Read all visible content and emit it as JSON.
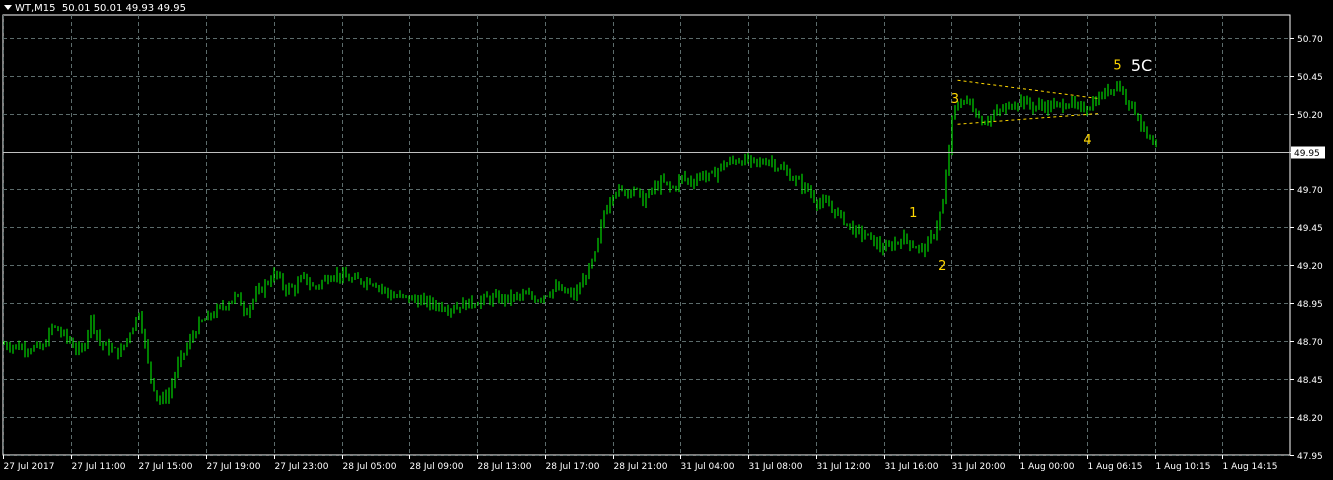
{
  "header": {
    "symbol_timeframe": "WT,M15",
    "ohlc_text": "50.01 50.01 49.93 49.95"
  },
  "colors": {
    "background": "#000000",
    "grid": "#5c6b6b",
    "candle": "#00ff00",
    "axis_text": "#ffffff",
    "price_line": "#c0c0c0",
    "wave_label": "#ffd700",
    "channel": "#ffd700"
  },
  "chart_data": {
    "type": "line",
    "title": "",
    "xlabel": "",
    "ylabel": "",
    "ylim": [
      47.95,
      50.85
    ],
    "grid": true,
    "y_ticks": [
      "50.70",
      "50.45",
      "50.20",
      "49.95",
      "49.70",
      "49.45",
      "49.20",
      "48.95",
      "48.70",
      "48.45",
      "48.20",
      "47.95"
    ],
    "x_ticks": [
      "27 Jul 2017",
      "27 Jul 11:00",
      "27 Jul 15:00",
      "27 Jul 19:00",
      "27 Jul 23:00",
      "28 Jul 05:00",
      "28 Jul 09:00",
      "28 Jul 13:00",
      "28 Jul 17:00",
      "28 Jul 21:00",
      "31 Jul 04:00",
      "31 Jul 08:00",
      "31 Jul 12:00",
      "31 Jul 16:00",
      "31 Jul 20:00",
      "1 Aug 00:00",
      "1 Aug 06:15",
      "1 Aug 10:15",
      "1 Aug 14:15"
    ],
    "current_price": "49.95",
    "series": [
      {
        "values": [
          [
            0,
            48.68
          ],
          [
            2,
            48.66
          ],
          [
            4,
            48.65
          ],
          [
            5,
            48.8
          ],
          [
            6,
            48.75
          ],
          [
            8,
            48.62
          ],
          [
            9,
            48.85
          ],
          [
            10,
            48.68
          ],
          [
            12,
            48.62
          ],
          [
            14,
            48.9
          ],
          [
            15,
            48.5
          ],
          [
            16,
            48.3
          ],
          [
            17,
            48.35
          ],
          [
            18,
            48.55
          ],
          [
            20,
            48.8
          ],
          [
            22,
            48.9
          ],
          [
            24,
            49.0
          ],
          [
            25,
            48.9
          ],
          [
            26,
            49.0
          ],
          [
            28,
            49.15
          ],
          [
            29,
            49.05
          ],
          [
            30,
            49.05
          ],
          [
            31,
            49.12
          ],
          [
            32,
            49.05
          ],
          [
            34,
            49.15
          ],
          [
            36,
            49.1
          ],
          [
            38,
            49.1
          ],
          [
            40,
            49.0
          ],
          [
            42,
            48.98
          ],
          [
            44,
            48.95
          ],
          [
            46,
            48.92
          ],
          [
            48,
            48.95
          ],
          [
            50,
            48.98
          ],
          [
            52,
            48.98
          ],
          [
            54,
            49.0
          ],
          [
            55,
            48.98
          ],
          [
            57,
            49.05
          ],
          [
            58,
            49.02
          ],
          [
            59,
            49.0
          ],
          [
            60,
            49.12
          ],
          [
            61,
            49.25
          ],
          [
            62,
            49.55
          ],
          [
            63,
            49.7
          ],
          [
            64,
            49.68
          ],
          [
            65,
            49.72
          ],
          [
            66,
            49.62
          ],
          [
            67,
            49.7
          ],
          [
            68,
            49.75
          ],
          [
            69,
            49.7
          ],
          [
            70,
            49.78
          ],
          [
            71,
            49.75
          ],
          [
            72,
            49.8
          ],
          [
            73,
            49.78
          ],
          [
            74,
            49.85
          ],
          [
            75,
            49.88
          ],
          [
            76,
            49.9
          ],
          [
            77,
            49.88
          ],
          [
            78,
            49.87
          ],
          [
            79,
            49.9
          ],
          [
            80,
            49.85
          ],
          [
            81,
            49.8
          ],
          [
            82,
            49.75
          ],
          [
            83,
            49.7
          ],
          [
            84,
            49.62
          ],
          [
            85,
            49.6
          ],
          [
            86,
            49.55
          ],
          [
            87,
            49.48
          ],
          [
            88,
            49.42
          ],
          [
            89,
            49.4
          ],
          [
            90,
            49.35
          ],
          [
            91,
            49.3
          ],
          [
            92,
            49.35
          ],
          [
            93,
            49.38
          ],
          [
            94,
            49.33
          ],
          [
            95,
            49.3
          ],
          [
            96,
            49.4
          ],
          [
            97,
            49.6
          ],
          [
            98,
            50.2
          ],
          [
            99,
            50.3
          ],
          [
            100,
            50.25
          ],
          [
            101,
            50.15
          ],
          [
            102,
            50.18
          ],
          [
            103,
            50.22
          ],
          [
            104,
            50.25
          ],
          [
            105,
            50.3
          ],
          [
            106,
            50.25
          ],
          [
            107,
            50.25
          ],
          [
            108,
            50.25
          ],
          [
            109,
            50.25
          ],
          [
            110,
            50.28
          ],
          [
            111,
            50.22
          ],
          [
            112,
            50.25
          ],
          [
            113,
            50.3
          ],
          [
            114,
            50.35
          ],
          [
            115,
            50.4
          ],
          [
            116,
            50.3
          ],
          [
            117,
            50.2
          ],
          [
            118,
            50.05
          ],
          [
            119,
            49.95
          ]
        ]
      }
    ],
    "annotations": [
      "1",
      "2",
      "3",
      "4",
      "5",
      "5C"
    ]
  }
}
